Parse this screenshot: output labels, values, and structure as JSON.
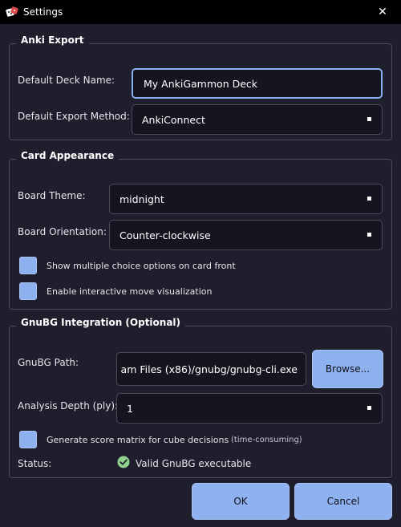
{
  "window": {
    "title": "Settings",
    "close_glyph": "✕",
    "accent_color": "#8eb1f0",
    "background_color": "#1e1e2c",
    "title_bar_color": "#000000"
  },
  "anki_export": {
    "title": "Anki Export",
    "deck_name_label": "Default Deck Name:",
    "deck_name_value": "My AnkiGammon Deck",
    "export_method_label": "Default Export Method:",
    "export_method_value": "AnkiConnect"
  },
  "card_appearance": {
    "title": "Card Appearance",
    "board_theme_label": "Board Theme:",
    "board_theme_value": "midnight",
    "board_orientation_label": "Board Orientation:",
    "board_orientation_value": "Counter-clockwise",
    "multiple_choice_label": "Show multiple choice options on card front",
    "interactive_move_label": "Enable interactive move visualization"
  },
  "gnubg": {
    "title": "GnuBG Integration (Optional)",
    "path_label": "GnuBG Path:",
    "path_value": "am Files (x86)/gnubg/gnubg-cli.exe",
    "browse_label": "Browse...",
    "analysis_depth_label": "Analysis Depth (ply):",
    "analysis_depth_value": "1",
    "score_matrix_label": "Generate score matrix for cube decisions",
    "score_matrix_hint": "(time-consuming)",
    "status_label": "Status:",
    "status_value": "Valid GnuBG executable",
    "status_icon": "check-circle-icon",
    "status_color": "#8fd18f"
  },
  "footer": {
    "ok_label": "OK",
    "cancel_label": "Cancel"
  }
}
